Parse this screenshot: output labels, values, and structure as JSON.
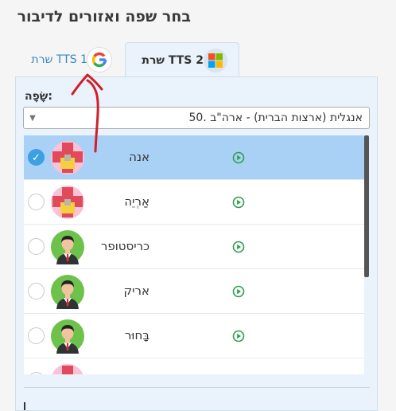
{
  "title": "בחר שפה ואזורים לדיבור",
  "tabs": [
    {
      "label": "TTS 1 שרת",
      "icon": "google-icon",
      "active": false
    },
    {
      "label": "TTS 2 שרת",
      "icon": "microsoft-icon",
      "active": true
    }
  ],
  "language": {
    "label": ":שָׂפָה",
    "selected": "אנגלית (ארצות הברית) - ארה\"ב .50"
  },
  "voices": [
    {
      "name": "אנה",
      "avatar": "female-avatar",
      "selected": true
    },
    {
      "name": "אַרְיֵה",
      "avatar": "female-avatar",
      "selected": false
    },
    {
      "name": "כריסטופר",
      "avatar": "male-avatar",
      "selected": false
    },
    {
      "name": "אריק",
      "avatar": "male-avatar",
      "selected": false
    },
    {
      "name": "בָּחוּר",
      "avatar": "male-avatar",
      "selected": false
    },
    {
      "name": "",
      "avatar": "female-avatar",
      "selected": false
    }
  ],
  "colors": {
    "accent": "#3ea0e0",
    "selected_row": "#a9d1f5",
    "play": "#2e9e4f",
    "annotation": "#d01f2a"
  }
}
